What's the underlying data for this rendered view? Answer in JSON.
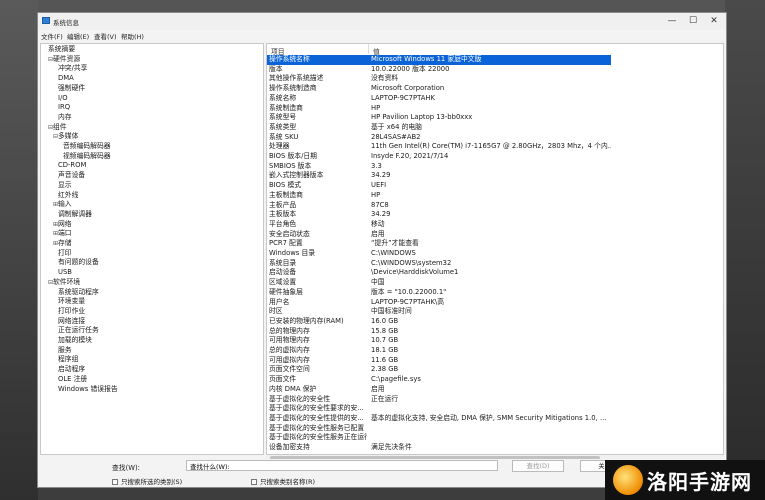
{
  "window": {
    "title": "系统信息"
  },
  "window_controls": {
    "minimize": "—",
    "maximize": "☐",
    "close": "✕"
  },
  "menu": [
    "文件(F)",
    "编辑(E)",
    "查看(V)",
    "帮助(H)"
  ],
  "tree": [
    {
      "label": "系统摘要",
      "level": 0,
      "expander": ""
    },
    {
      "label": "硬件资源",
      "level": 1,
      "expander": "⊟"
    },
    {
      "label": "冲突/共享",
      "level": 2,
      "expander": ""
    },
    {
      "label": "DMA",
      "level": 2,
      "expander": ""
    },
    {
      "label": "强制硬件",
      "level": 2,
      "expander": ""
    },
    {
      "label": "I/O",
      "level": 2,
      "expander": ""
    },
    {
      "label": "IRQ",
      "level": 2,
      "expander": ""
    },
    {
      "label": "内存",
      "level": 2,
      "expander": ""
    },
    {
      "label": "组件",
      "level": 1,
      "expander": "⊟"
    },
    {
      "label": "多媒体",
      "level": 2,
      "expander": "⊟"
    },
    {
      "label": "音频编码解码器",
      "level": 3,
      "expander": ""
    },
    {
      "label": "视频编码解码器",
      "level": 3,
      "expander": ""
    },
    {
      "label": "CD-ROM",
      "level": 2,
      "expander": ""
    },
    {
      "label": "声音设备",
      "level": 2,
      "expander": ""
    },
    {
      "label": "显示",
      "level": 2,
      "expander": ""
    },
    {
      "label": "红外线",
      "level": 2,
      "expander": ""
    },
    {
      "label": "输入",
      "level": 2,
      "expander": "⊞"
    },
    {
      "label": "调制解调器",
      "level": 2,
      "expander": ""
    },
    {
      "label": "网络",
      "level": 2,
      "expander": "⊞"
    },
    {
      "label": "端口",
      "level": 2,
      "expander": "⊞"
    },
    {
      "label": "存储",
      "level": 2,
      "expander": "⊞"
    },
    {
      "label": "打印",
      "level": 2,
      "expander": ""
    },
    {
      "label": "有问题的设备",
      "level": 2,
      "expander": ""
    },
    {
      "label": "USB",
      "level": 2,
      "expander": ""
    },
    {
      "label": "软件环境",
      "level": 1,
      "expander": "⊟"
    },
    {
      "label": "系统驱动程序",
      "level": 2,
      "expander": ""
    },
    {
      "label": "环境变量",
      "level": 2,
      "expander": ""
    },
    {
      "label": "打印作业",
      "level": 2,
      "expander": ""
    },
    {
      "label": "网络连接",
      "level": 2,
      "expander": ""
    },
    {
      "label": "正在运行任务",
      "level": 2,
      "expander": ""
    },
    {
      "label": "加载的模块",
      "level": 2,
      "expander": ""
    },
    {
      "label": "服务",
      "level": 2,
      "expander": ""
    },
    {
      "label": "程序组",
      "level": 2,
      "expander": ""
    },
    {
      "label": "启动程序",
      "level": 2,
      "expander": ""
    },
    {
      "label": "OLE 注册",
      "level": 2,
      "expander": ""
    },
    {
      "label": "Windows 错误报告",
      "level": 2,
      "expander": ""
    }
  ],
  "list": {
    "headers": [
      "项目",
      "值"
    ],
    "rows": [
      [
        "操作系统名称",
        "Microsoft Windows 11 家庭中文版"
      ],
      [
        "版本",
        "10.0.22000 版本 22000"
      ],
      [
        "其他操作系统描述",
        "没有资料"
      ],
      [
        "操作系统制造商",
        "Microsoft Corporation"
      ],
      [
        "系统名称",
        "LAPTOP-9C7PTAHK"
      ],
      [
        "系统制造商",
        "HP"
      ],
      [
        "系统型号",
        "HP Pavilion Laptop 13-bb0xxx"
      ],
      [
        "系统类型",
        "基于 x64 的电脑"
      ],
      [
        "系统 SKU",
        "28L4SAS#AB2"
      ],
      [
        "处理器",
        "11th Gen Intel(R) Core(TM) i7-1165G7 @ 2.80GHz，2803 Mhz，4 个内..."
      ],
      [
        "BIOS 版本/日期",
        "Insyde F.20, 2021/7/14"
      ],
      [
        "SMBIOS 版本",
        "3.3"
      ],
      [
        "嵌入式控制器版本",
        "34.29"
      ],
      [
        "BIOS 模式",
        "UEFI"
      ],
      [
        "主板制造商",
        "HP"
      ],
      [
        "主板产品",
        "87C8"
      ],
      [
        "主板版本",
        "34.29"
      ],
      [
        "平台角色",
        "移动"
      ],
      [
        "安全启动状态",
        "启用"
      ],
      [
        "PCR7 配置",
        "“提升”才能查看"
      ],
      [
        "Windows 目录",
        "C:\\WINDOWS"
      ],
      [
        "系统目录",
        "C:\\WINDOWS\\system32"
      ],
      [
        "启动设备",
        "\\Device\\HarddiskVolume1"
      ],
      [
        "区域设置",
        "中国"
      ],
      [
        "硬件抽象层",
        "版本 = \"10.0.22000.1\""
      ],
      [
        "用户名",
        "LAPTOP-9C7PTAHK\\高"
      ],
      [
        "时区",
        "中国标准时间"
      ],
      [
        "已安装的物理内存(RAM)",
        "16.0 GB"
      ],
      [
        "总的物理内存",
        "15.8 GB"
      ],
      [
        "可用物理内存",
        "10.7 GB"
      ],
      [
        "总的虚拟内存",
        "18.1 GB"
      ],
      [
        "可用虚拟内存",
        "11.6 GB"
      ],
      [
        "页面文件空间",
        "2.38 GB"
      ],
      [
        "页面文件",
        "C:\\pagefile.sys"
      ],
      [
        "内核 DMA 保护",
        "启用"
      ],
      [
        "基于虚拟化的安全性",
        "正在运行"
      ],
      [
        "基于虚拟化的安全性要求的安...",
        ""
      ],
      [
        "基于虚拟化的安全性提供的安...",
        "基本的虚拟化支持, 安全启动, DMA 保护, SMM Security Mitigations 1.0, ..."
      ],
      [
        "基于虚拟化的安全性服务已配置",
        ""
      ],
      [
        "基于虚拟化的安全性服务正在运行",
        ""
      ],
      [
        "设备加密支持",
        "满足先决条件"
      ]
    ]
  },
  "find": {
    "label": "查找(W):",
    "value": "查找什么(W):",
    "find_button": "查找(D)",
    "close_button": "关闭查找(C)",
    "check_selected": "只搜索所选的类别(S)",
    "check_names": "只搜索类别名称(R)"
  },
  "watermark": {
    "text": "洛阳手游网"
  },
  "colors": {
    "selection": "#0a64d8",
    "window_bg": "#f3f3f3"
  }
}
